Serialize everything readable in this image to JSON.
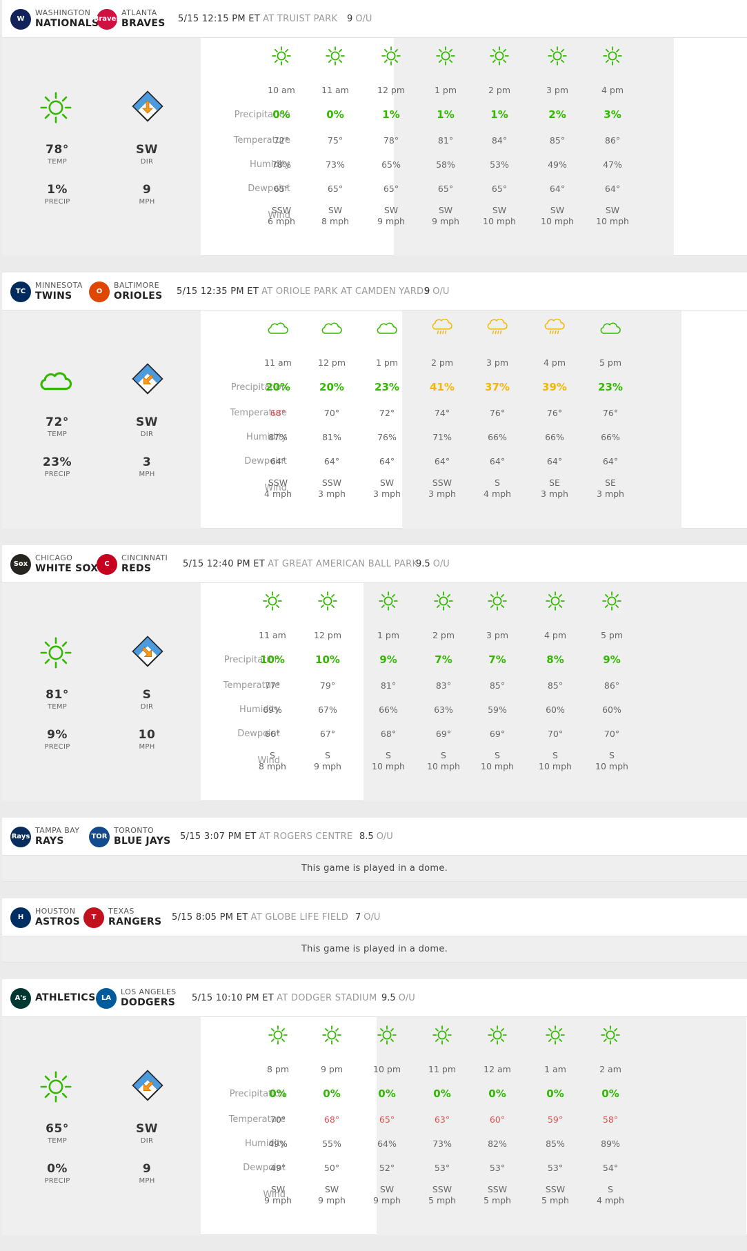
{
  "row_labels": {
    "precip": "Precipitation",
    "temp": "Temperature",
    "humidity": "Humidity",
    "dewpoint": "Dewpoint",
    "wind": "Wind"
  },
  "stat_labels": {
    "temp": "TEMP",
    "dir": "DIR",
    "precip": "PRECIP",
    "mph": "MPH"
  },
  "ou_label": "O/U",
  "colors": {
    "green": "#33b800",
    "yellow": "#f2b705",
    "red": "#e05050",
    "panel": "#efefef"
  },
  "games": [
    {
      "away": {
        "city": "WASHINGTON",
        "nick": "NATIONALS",
        "logo_text": "W",
        "logo_color": "#14225a",
        "logo_icon": "nationals-logo"
      },
      "home": {
        "city": "ATLANTA",
        "nick": "BRAVES",
        "logo_text": "Braves",
        "logo_color": "#ce1141",
        "logo_icon": "braves-logo"
      },
      "datetime": "5/15 12:15 PM ET",
      "venue": "AT TRUIST PARK",
      "ou": "9",
      "summary": {
        "icon": "sun-icon",
        "temp": "78°",
        "dir": "SW",
        "precip": "1%",
        "mph": "9",
        "arrow_rotation": 180
      },
      "hours": [
        {
          "time": "10 am",
          "icon": "sun",
          "precip": "0%",
          "pc": "green",
          "temp": "72°",
          "tc": "",
          "humidity": "78%",
          "dewpoint": "65°",
          "wind_dir": "SSW",
          "wind_speed": "6 mph"
        },
        {
          "time": "11 am",
          "icon": "sun",
          "precip": "0%",
          "pc": "green",
          "temp": "75°",
          "tc": "",
          "humidity": "73%",
          "dewpoint": "65°",
          "wind_dir": "SW",
          "wind_speed": "8 mph"
        },
        {
          "time": "12 pm",
          "icon": "sun",
          "precip": "1%",
          "pc": "green",
          "temp": "78°",
          "tc": "",
          "humidity": "65%",
          "dewpoint": "65°",
          "wind_dir": "SW",
          "wind_speed": "9 mph"
        },
        {
          "time": "1 pm",
          "icon": "sun",
          "precip": "1%",
          "pc": "green",
          "temp": "81°",
          "tc": "",
          "humidity": "58%",
          "dewpoint": "65°",
          "wind_dir": "SW",
          "wind_speed": "9 mph"
        },
        {
          "time": "2 pm",
          "icon": "sun",
          "precip": "1%",
          "pc": "green",
          "temp": "84°",
          "tc": "",
          "humidity": "53%",
          "dewpoint": "65°",
          "wind_dir": "SW",
          "wind_speed": "10 mph"
        },
        {
          "time": "3 pm",
          "icon": "sun",
          "precip": "2%",
          "pc": "green",
          "temp": "85°",
          "tc": "",
          "humidity": "49%",
          "dewpoint": "64°",
          "wind_dir": "SW",
          "wind_speed": "10 mph"
        },
        {
          "time": "4 pm",
          "icon": "sun",
          "precip": "3%",
          "pc": "green",
          "temp": "86°",
          "tc": "",
          "humidity": "47%",
          "dewpoint": "64°",
          "wind_dir": "SW",
          "wind_speed": "10 mph"
        }
      ]
    },
    {
      "away": {
        "city": "MINNESOTA",
        "nick": "TWINS",
        "logo_text": "TC",
        "logo_color": "#002b5c",
        "logo_icon": "twins-logo"
      },
      "home": {
        "city": "BALTIMORE",
        "nick": "ORIOLES",
        "logo_text": "O",
        "logo_color": "#df4601",
        "logo_icon": "orioles-logo"
      },
      "datetime": "5/15 12:35 PM ET",
      "venue": "AT ORIOLE PARK AT CAMDEN YARDS",
      "ou": "9",
      "summary": {
        "icon": "cloud-icon",
        "temp": "72°",
        "dir": "SW",
        "precip": "23%",
        "mph": "3",
        "arrow_rotation": 225
      },
      "hours": [
        {
          "time": "11 am",
          "icon": "cloud",
          "precip": "20%",
          "pc": "green",
          "temp": "68°",
          "tc": "red",
          "humidity": "87%",
          "dewpoint": "64°",
          "wind_dir": "SSW",
          "wind_speed": "4 mph"
        },
        {
          "time": "12 pm",
          "icon": "cloud",
          "precip": "20%",
          "pc": "green",
          "temp": "70°",
          "tc": "",
          "humidity": "81%",
          "dewpoint": "64°",
          "wind_dir": "SSW",
          "wind_speed": "3 mph"
        },
        {
          "time": "1 pm",
          "icon": "cloud",
          "precip": "23%",
          "pc": "green",
          "temp": "72°",
          "tc": "",
          "humidity": "76%",
          "dewpoint": "64°",
          "wind_dir": "SW",
          "wind_speed": "3 mph"
        },
        {
          "time": "2 pm",
          "icon": "rain",
          "precip": "41%",
          "pc": "yellow",
          "temp": "74°",
          "tc": "",
          "humidity": "71%",
          "dewpoint": "64°",
          "wind_dir": "SSW",
          "wind_speed": "3 mph"
        },
        {
          "time": "3 pm",
          "icon": "rain",
          "precip": "37%",
          "pc": "yellow",
          "temp": "76°",
          "tc": "",
          "humidity": "66%",
          "dewpoint": "64°",
          "wind_dir": "S",
          "wind_speed": "4 mph"
        },
        {
          "time": "4 pm",
          "icon": "rain",
          "precip": "39%",
          "pc": "yellow",
          "temp": "76°",
          "tc": "",
          "humidity": "66%",
          "dewpoint": "64°",
          "wind_dir": "SE",
          "wind_speed": "3 mph"
        },
        {
          "time": "5 pm",
          "icon": "cloud",
          "precip": "23%",
          "pc": "green",
          "temp": "76°",
          "tc": "",
          "humidity": "66%",
          "dewpoint": "64°",
          "wind_dir": "SE",
          "wind_speed": "3 mph"
        }
      ]
    },
    {
      "away": {
        "city": "CHICAGO",
        "nick": "WHITE SOX",
        "logo_text": "Sox",
        "logo_color": "#27251f",
        "logo_icon": "white-sox-logo"
      },
      "home": {
        "city": "CINCINNATI",
        "nick": "REDS",
        "logo_text": "C",
        "logo_color": "#c6011f",
        "logo_icon": "reds-logo"
      },
      "datetime": "5/15 12:40 PM ET",
      "venue": "AT GREAT AMERICAN BALL PARK",
      "ou": "9.5",
      "summary": {
        "icon": "sun-icon",
        "temp": "81°",
        "dir": "S",
        "precip": "9%",
        "mph": "10",
        "arrow_rotation": 135
      },
      "hours": [
        {
          "time": "11 am",
          "icon": "sun",
          "precip": "10%",
          "pc": "green",
          "temp": "77°",
          "tc": "",
          "humidity": "69%",
          "dewpoint": "66°",
          "wind_dir": "S",
          "wind_speed": "8 mph"
        },
        {
          "time": "12 pm",
          "icon": "sun",
          "precip": "10%",
          "pc": "green",
          "temp": "79°",
          "tc": "",
          "humidity": "67%",
          "dewpoint": "67°",
          "wind_dir": "S",
          "wind_speed": "9 mph"
        },
        {
          "time": "1 pm",
          "icon": "sun",
          "precip": "9%",
          "pc": "green",
          "temp": "81°",
          "tc": "",
          "humidity": "66%",
          "dewpoint": "68°",
          "wind_dir": "S",
          "wind_speed": "10 mph"
        },
        {
          "time": "2 pm",
          "icon": "sun",
          "precip": "7%",
          "pc": "green",
          "temp": "83°",
          "tc": "",
          "humidity": "63%",
          "dewpoint": "69°",
          "wind_dir": "S",
          "wind_speed": "10 mph"
        },
        {
          "time": "3 pm",
          "icon": "sun",
          "precip": "7%",
          "pc": "green",
          "temp": "85°",
          "tc": "",
          "humidity": "59%",
          "dewpoint": "69°",
          "wind_dir": "S",
          "wind_speed": "10 mph"
        },
        {
          "time": "4 pm",
          "icon": "sun",
          "precip": "8%",
          "pc": "green",
          "temp": "85°",
          "tc": "",
          "humidity": "60%",
          "dewpoint": "70°",
          "wind_dir": "S",
          "wind_speed": "10 mph"
        },
        {
          "time": "5 pm",
          "icon": "sun",
          "precip": "9%",
          "pc": "green",
          "temp": "86°",
          "tc": "",
          "humidity": "60%",
          "dewpoint": "70°",
          "wind_dir": "S",
          "wind_speed": "10 mph"
        }
      ]
    },
    {
      "away": {
        "city": "TAMPA BAY",
        "nick": "RAYS",
        "logo_text": "Rays",
        "logo_color": "#092c5c",
        "logo_icon": "rays-logo"
      },
      "home": {
        "city": "TORONTO",
        "nick": "BLUE JAYS",
        "logo_text": "TOR",
        "logo_color": "#134a8e",
        "logo_icon": "blue-jays-logo"
      },
      "datetime": "5/15 3:07 PM ET",
      "venue": "AT ROGERS CENTRE",
      "ou": "8.5",
      "dome": "This game is played in a dome."
    },
    {
      "away": {
        "city": "HOUSTON",
        "nick": "ASTROS",
        "logo_text": "H",
        "logo_color": "#002d62",
        "logo_icon": "astros-logo"
      },
      "home": {
        "city": "TEXAS",
        "nick": "RANGERS",
        "logo_text": "T",
        "logo_color": "#c0111f",
        "logo_icon": "rangers-logo"
      },
      "datetime": "5/15 8:05 PM ET",
      "venue": "AT GLOBE LIFE FIELD",
      "ou": "7",
      "dome": "This game is played in a dome."
    },
    {
      "away": {
        "city": "",
        "nick": "ATHLETICS",
        "logo_text": "A's",
        "logo_color": "#003831",
        "logo_icon": "athletics-logo"
      },
      "home": {
        "city": "LOS ANGELES",
        "nick": "DODGERS",
        "logo_text": "LA",
        "logo_color": "#005a9c",
        "logo_icon": "dodgers-logo"
      },
      "datetime": "5/15 10:10 PM ET",
      "venue": "AT DODGER STADIUM",
      "ou": "9.5",
      "summary": {
        "icon": "sun-icon",
        "temp": "65°",
        "dir": "SW",
        "precip": "0%",
        "mph": "9",
        "arrow_rotation": 225
      },
      "hours": [
        {
          "time": "8 pm",
          "icon": "sun",
          "precip": "0%",
          "pc": "green",
          "temp": "70°",
          "tc": "",
          "humidity": "49%",
          "dewpoint": "49°",
          "wind_dir": "SW",
          "wind_speed": "9 mph"
        },
        {
          "time": "9 pm",
          "icon": "sun",
          "precip": "0%",
          "pc": "green",
          "temp": "68°",
          "tc": "red",
          "humidity": "55%",
          "dewpoint": "50°",
          "wind_dir": "SW",
          "wind_speed": "9 mph"
        },
        {
          "time": "10 pm",
          "icon": "sun",
          "precip": "0%",
          "pc": "green",
          "temp": "65°",
          "tc": "red",
          "humidity": "64%",
          "dewpoint": "52°",
          "wind_dir": "SW",
          "wind_speed": "9 mph"
        },
        {
          "time": "11 pm",
          "icon": "sun",
          "precip": "0%",
          "pc": "green",
          "temp": "63°",
          "tc": "red",
          "humidity": "73%",
          "dewpoint": "53°",
          "wind_dir": "SSW",
          "wind_speed": "5 mph"
        },
        {
          "time": "12 am",
          "icon": "sun",
          "precip": "0%",
          "pc": "green",
          "temp": "60°",
          "tc": "red",
          "humidity": "82%",
          "dewpoint": "53°",
          "wind_dir": "SSW",
          "wind_speed": "5 mph"
        },
        {
          "time": "1 am",
          "icon": "sun",
          "precip": "0%",
          "pc": "green",
          "temp": "59°",
          "tc": "red",
          "humidity": "85%",
          "dewpoint": "53°",
          "wind_dir": "SSW",
          "wind_speed": "5 mph"
        },
        {
          "time": "2 am",
          "icon": "sun",
          "precip": "0%",
          "pc": "green",
          "temp": "58°",
          "tc": "red",
          "humidity": "89%",
          "dewpoint": "54°",
          "wind_dir": "S",
          "wind_speed": "4 mph"
        }
      ]
    }
  ]
}
